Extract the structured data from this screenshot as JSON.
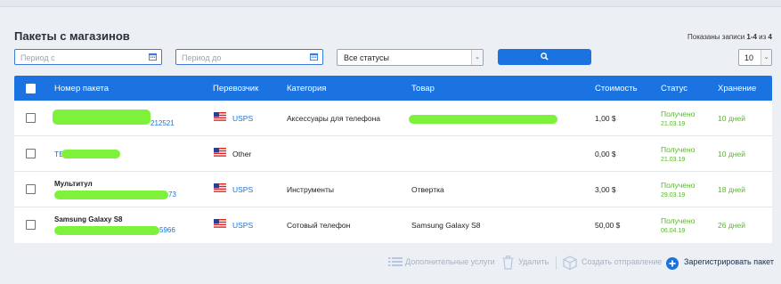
{
  "header": {
    "title": "Пакеты с магазинов",
    "records_prefix": "Показаны записи ",
    "records_range": "1-4",
    "records_mid": " из ",
    "records_total": "4"
  },
  "filters": {
    "date_from_placeholder": "Период с",
    "date_to_placeholder": "Период до",
    "status_selected": "Все статусы",
    "per_page_selected": "10"
  },
  "table": {
    "columns": [
      "Номер пакета",
      "Перевозчик",
      "Категория",
      "Товар",
      "Стоимость",
      "Статус",
      "Хранение"
    ],
    "rows": [
      {
        "number_label": "",
        "number_suffix": "212521",
        "carrier": "USPS",
        "carrier_link": true,
        "category": "Аксессуары для телефона",
        "product": "",
        "cost": "1,00 $",
        "status": "Получено",
        "status_date": "21.03.19",
        "storage": "10 дней"
      },
      {
        "number_label": "",
        "number_suffix": "TE",
        "carrier": "Other",
        "carrier_link": false,
        "category": "",
        "product": "",
        "cost": "0,00 $",
        "status": "Получено",
        "status_date": "21.03.19",
        "storage": "10 дней"
      },
      {
        "number_label": "Мультитул",
        "number_suffix": "73",
        "carrier": "USPS",
        "carrier_link": true,
        "category": "Инструменты",
        "product": "Отвертка",
        "cost": "3,00 $",
        "status": "Получено",
        "status_date": "29.03.19",
        "storage": "18 дней"
      },
      {
        "number_label": "Samsung Galaxy S8",
        "number_suffix": "5966",
        "carrier": "USPS",
        "carrier_link": true,
        "category": "Сотовый телефон",
        "product": "Samsung Galaxy S8",
        "cost": "50,00 $",
        "status": "Получено",
        "status_date": "06.04.19",
        "storage": "26 дней"
      }
    ]
  },
  "actions": {
    "extra_services": "Дополнительные услуги",
    "delete": "Удалить",
    "create_shipment": "Создать отправление",
    "register_package": "Зарегистрировать пакет"
  },
  "colors": {
    "accent": "#1a73e0",
    "success": "#5cb531",
    "redaction": "#7ef23a"
  }
}
